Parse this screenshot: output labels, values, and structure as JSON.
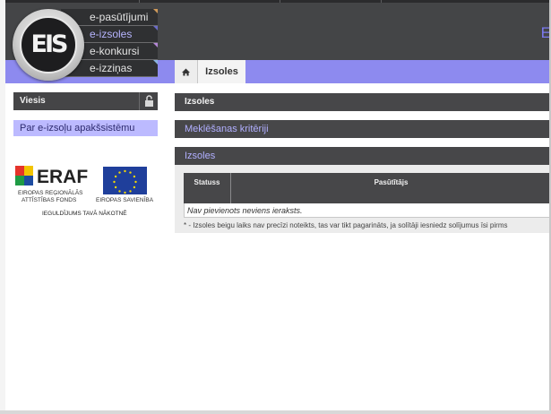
{
  "header": {
    "logo_text": "EIS",
    "menu": [
      {
        "label": "e-pasūtījumi",
        "active": false
      },
      {
        "label": "e-izsoles",
        "active": true
      },
      {
        "label": "e-konkursi",
        "active": false
      },
      {
        "label": "e-izziņas",
        "active": false
      }
    ],
    "brand_letter": "E",
    "accent": "#8d8aef",
    "bar_color": "#444547"
  },
  "tabs": [
    {
      "icon": "home-icon"
    },
    {
      "label": "Izsoles"
    }
  ],
  "sidebar": {
    "user_label": "Viesis",
    "lock_icon": "lock-icon",
    "link_label": "Par e-izsoļu apakšsistēmu",
    "eraf": {
      "logo_text": "ERAF",
      "fund_line1": "EIROPAS REĢIONĀLĀS",
      "fund_line2": "ATTĪSTĪBAS FONDS",
      "eu_label": "EIROPAS SAVIENĪBA",
      "slogan": "IEGULDĪJUMS TAVĀ NĀKOTNĒ"
    }
  },
  "main": {
    "section_title": "Izsoles",
    "criteria_label": "Meklēšanas kritēriji",
    "list_title": "Izsoles",
    "table": {
      "columns": [
        "Statuss",
        "Pasūtītājs"
      ],
      "empty_text": "Nav pievienots neviens ieraksts."
    },
    "footnote": "* - Izsoles beigu laiks nav precīzi noteikts, tas var tikt pagarināts, ja solītāji iesniedz solījumus īsi pirms"
  }
}
